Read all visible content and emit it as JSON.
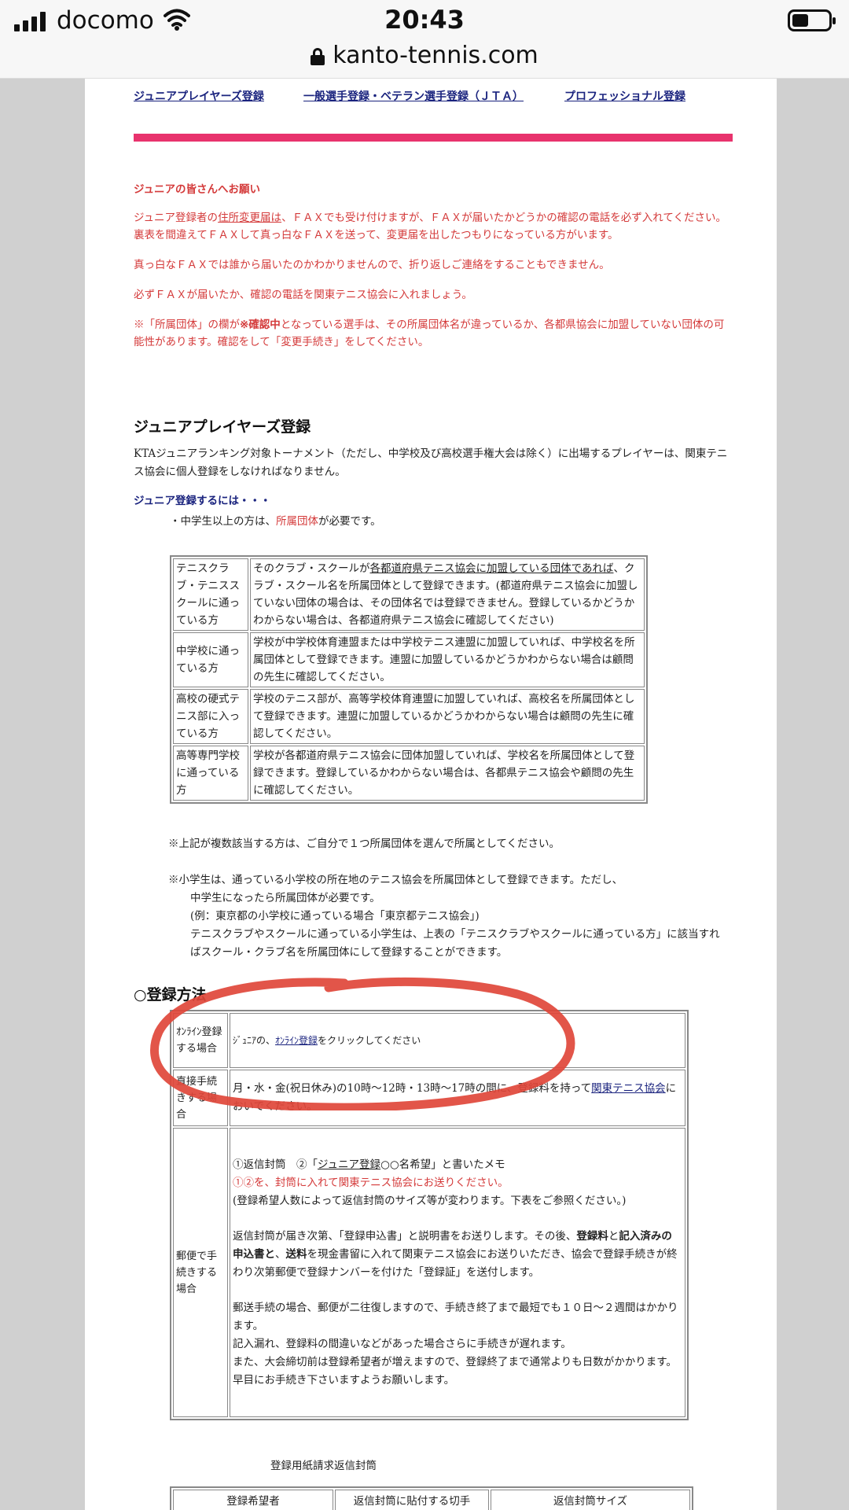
{
  "status_bar": {
    "carrier": "docomo",
    "time": "20:43",
    "battery_level": 0.45,
    "url": "kanto-tennis.com"
  },
  "topnav": {
    "junior_link": "ジュニアプレイヤーズ登録",
    "general_link": "一般選手登録・ベテラン選手登録（ＪＴＡ）",
    "pro_link": "プロフェッショナル登録"
  },
  "notice": {
    "title": "ジュニアの皆さんへお願い",
    "p1_pre": "ジュニア登録者の",
    "p1_link": "住所変更届は",
    "p1_post": "、ＦＡＸでも受け付けますが、ＦＡＸが届いたかどうかの確認の電話を必ず入れてください。裏表を間違えてＦＡＸして真っ白なＦＡＸを送って、変更届を出したつもりになっている方がいます。",
    "p2": "真っ白なＦＡＸでは誰から届いたのかわかりませんので、折り返しご連絡をすることもできません。",
    "p3": "必ずＦＡＸが届いたか、確認の電話を関東テニス協会に入れましょう。",
    "p4_pre": "※「所属団体」の欄が",
    "p4_bold": "※確認中",
    "p4_post": "となっている選手は、その所属団体名が違っているか、各都県協会に加盟していない団体の可能性があります。確認をして「変更手続き」をしてください。"
  },
  "junior_section": {
    "heading": "ジュニアプレイヤーズ登録",
    "intro": "KTAジュニアランキング対象トーナメント（ただし、中学校及び高校選手権大会は除く）に出場するプレイヤーは、関東テニス協会に個人登録をしなければなりません。",
    "howto_title": "ジュニア登録するには・・・",
    "bullet_pre": "・中学生以上の方は、",
    "bullet_red": "所属団体",
    "bullet_post": "が必要です。"
  },
  "affiliation_table": [
    {
      "label": "テニスクラブ・テニススクールに通っている方",
      "text_pre": "そのクラブ・スクールが",
      "text_u": "各都道府県テニス協会に加盟している団体であれば",
      "text_post": "、クラブ・スクール名を所属団体として登録できます。(都道府県テニス協会に加盟していない団体の場合は、その団体名では登録できません。登録しているかどうかわからない場合は、各都道府県テニス協会に確認してください)"
    },
    {
      "label": "中学校に通っている方",
      "text_pre": "学校が中学校体育連盟または中学校テニス連盟に加盟していれば、中学校名を所属団体として登録できます。連盟に加盟しているかどうかわからない場合は顧問の先生に確認してください。",
      "text_u": "",
      "text_post": ""
    },
    {
      "label": "高校の硬式テニス部に入っている方",
      "text_pre": "学校のテニス部が、高等学校体育連盟に加盟していれば、高校名を所属団体として登録できます。連盟に加盟しているかどうかわからない場合は顧問の先生に確認してください。",
      "text_u": "",
      "text_post": ""
    },
    {
      "label": "高等専門学校に通っている方",
      "text_pre": "学校が各都道府県テニス協会に団体加盟していれば、学校名を所属団体として登録できます。登録しているかわからない場合は、各都県テニス協会や顧問の先生に確認してください。",
      "text_u": "",
      "text_post": ""
    }
  ],
  "notes": {
    "n1": "※上記が複数該当する方は、ご自分で１つ所属団体を選んで所属としてください。",
    "n2_line1": "※小学生は、通っている小学校の所在地のテニス協会を所属団体として登録できます。ただし、",
    "n2_line2": "中学生になったら所属団体が必要です。",
    "n2_line3": "(例：東京都の小学校に通っている場合「東京都テニス協会」)",
    "n2_line4": "テニスクラブやスクールに通っている小学生は、上表の「テニスクラブやスクールに通っている方」に該当すればスクール・クラブ名を所属団体にして登録することができます。"
  },
  "registration": {
    "heading": "○登録方法",
    "online_label": "ｵﾝﾗｲﾝ登録する場合",
    "online_pre": "ｼﾞｭﾆｱの、",
    "online_link": "ｵﾝﾗｲﾝ登録",
    "online_post": "をクリックしてください",
    "direct_label": "直接手続きする場合",
    "direct_pre": "月・水・金(祝日休み)の10時〜12時・13時〜17時の間に、登録料を持って",
    "direct_link": "関東テニス協会",
    "direct_post": "においでください。",
    "mail_label": "郵便で手続きする場合",
    "mail_l1_pre": "①返信封筒　②「",
    "mail_l1_u": "ジュニア登録",
    "mail_l1_post": "○○名希望」と書いたメモ",
    "mail_l2": "①②を、封筒に入れて関東テニス協会にお送りください。",
    "mail_l3": "(登録希望人数によって返信封筒のサイズ等が変わります。下表をご参照ください。)",
    "mail_p2_a": "返信封筒が届き次第、「登録申込書」と説明書をお送りします。その後、",
    "mail_p2_b1": "登録料",
    "mail_p2_c": "と",
    "mail_p2_b2": "記入済みの申込書と",
    "mail_p2_d": "、",
    "mail_p2_b3": "送料",
    "mail_p2_e": "を現金書留に入れて関東テニス協会にお送りいただき、協会で登録手続きが終わり次第郵便で登録ナンバーを付けた「登録証」を送付します。",
    "mail_p3": "郵送手続の場合、郵便が二往復しますので、手続き終了まで最短でも１０日〜２週間はかかります。",
    "mail_p4": "記入漏れ、登録料の間違いなどがあった場合さらに手続きが遅れます。",
    "mail_p5": "また、大会締切前は登録希望者が増えますので、登録終了まで通常よりも日数がかかります。早目にお手続き下さいますようお願いします。"
  },
  "envelope_table": {
    "caption": "登録用紙請求返信封筒",
    "headers": [
      "登録希望者",
      "返信封筒に貼付する切手",
      "返信封筒サイズ"
    ]
  },
  "colors": {
    "accent_pink": "#e8336d",
    "notice_red": "#d43a3a",
    "link_navy": "#1a237e",
    "marker_red": "#e0463a"
  }
}
